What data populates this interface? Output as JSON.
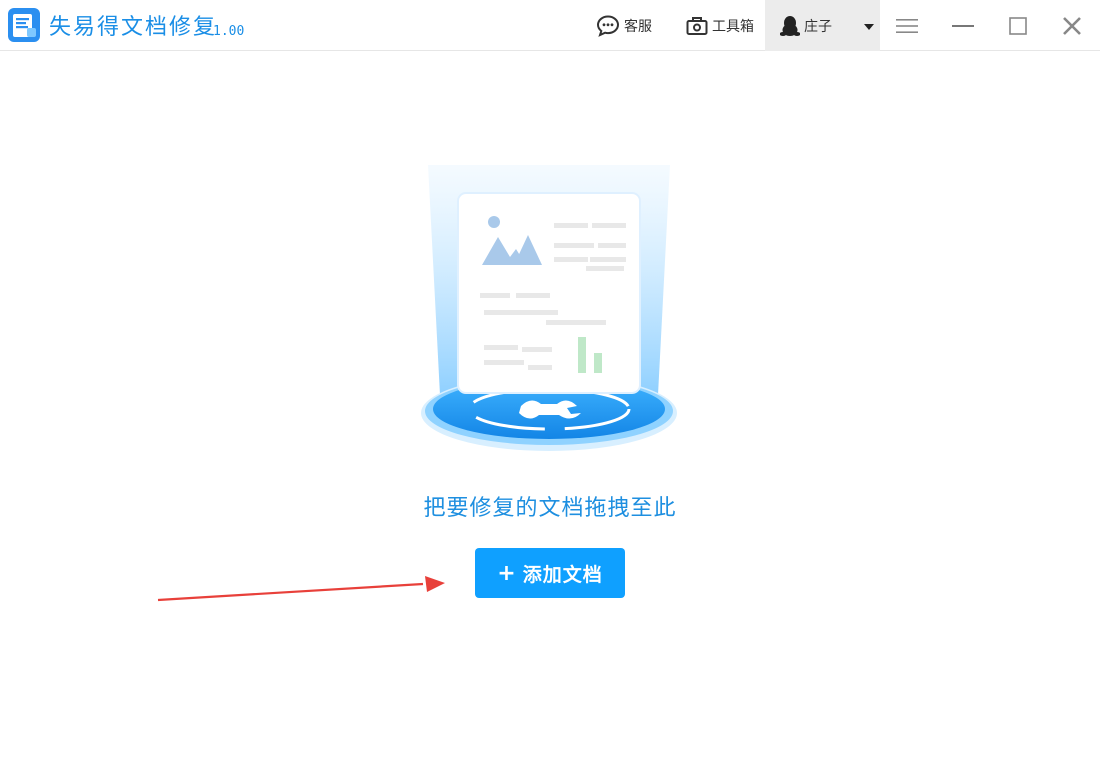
{
  "app": {
    "title": "失易得文档修复",
    "version": "1.00",
    "logo_icon": "document-repair-logo-icon",
    "accent_color": "#1a8ee6"
  },
  "header": {
    "service_label": "客服",
    "toolbox_label": "工具箱",
    "user_label": "庄子"
  },
  "window_controls": {
    "menu_icon": "hamburger-icon",
    "minimize_icon": "minimize-icon",
    "maximize_icon": "maximize-icon",
    "close_icon": "close-icon"
  },
  "main": {
    "illustration_icon": "document-repair-illustration-icon",
    "drop_hint": "把要修复的文档拖拽至此",
    "add_button": {
      "plus": "+",
      "label": "添加文档",
      "color": "#0fa0ff"
    },
    "annotation_arrow_color": "#e8403a"
  }
}
